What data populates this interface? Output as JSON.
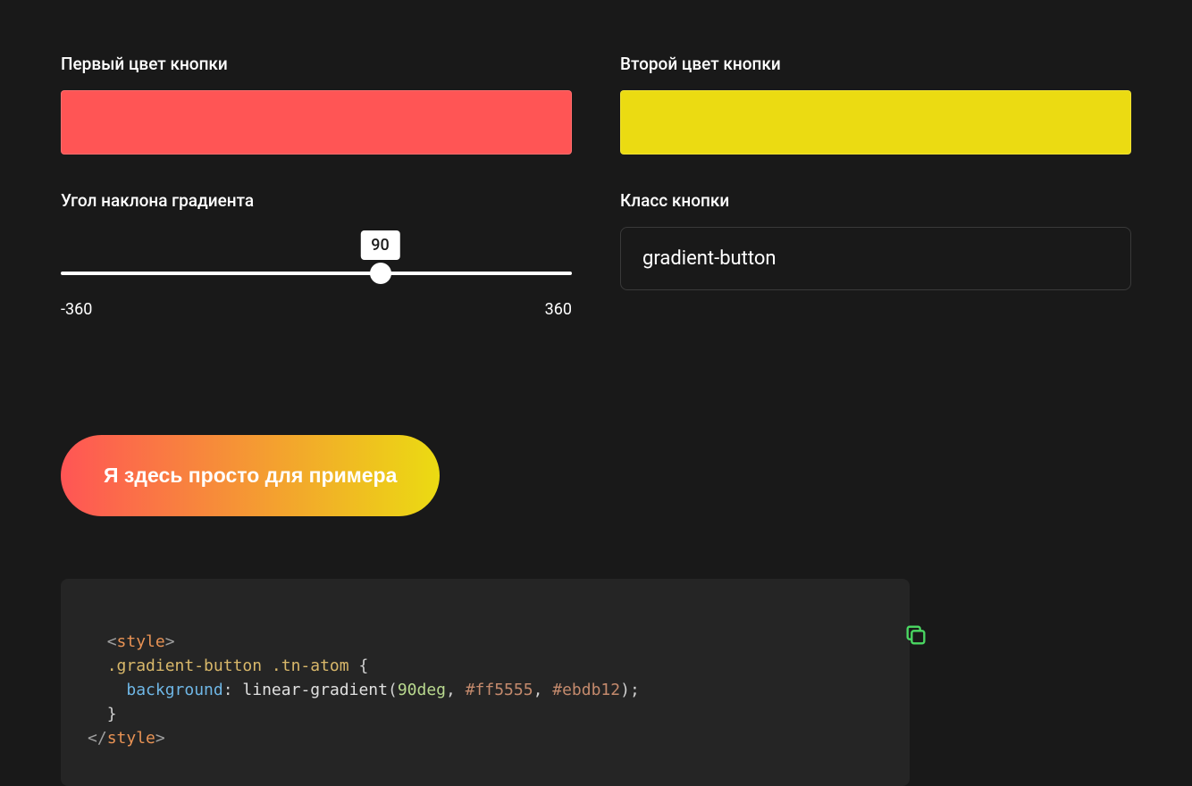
{
  "labels": {
    "first_color": "Первый цвет кнопки",
    "second_color": "Второй цвет кнопки",
    "gradient_angle": "Угол наклона градиента",
    "button_class": "Класс кнопки"
  },
  "colors": {
    "first": "#ff5555",
    "second": "#ebdb12"
  },
  "slider": {
    "min": "-360",
    "max": "360",
    "value": "90",
    "percent": 62.5
  },
  "class_input": {
    "value": "gradient-button"
  },
  "preview": {
    "button_text": "Я здесь просто для примера"
  },
  "code": {
    "open_br": "<",
    "close_br": ">",
    "open_slash": "</",
    "tag_style": "style",
    "selector": ".gradient-button .tn-atom",
    "lbrace": "{",
    "rbrace": "}",
    "prop": "background",
    "colon": ":",
    "func": "linear-gradient",
    "lparen": "(",
    "rparen": ")",
    "angle": "90deg",
    "comma": ",",
    "hex1": "#ff5555",
    "hex2": "#ebdb12",
    "semi": ";"
  }
}
